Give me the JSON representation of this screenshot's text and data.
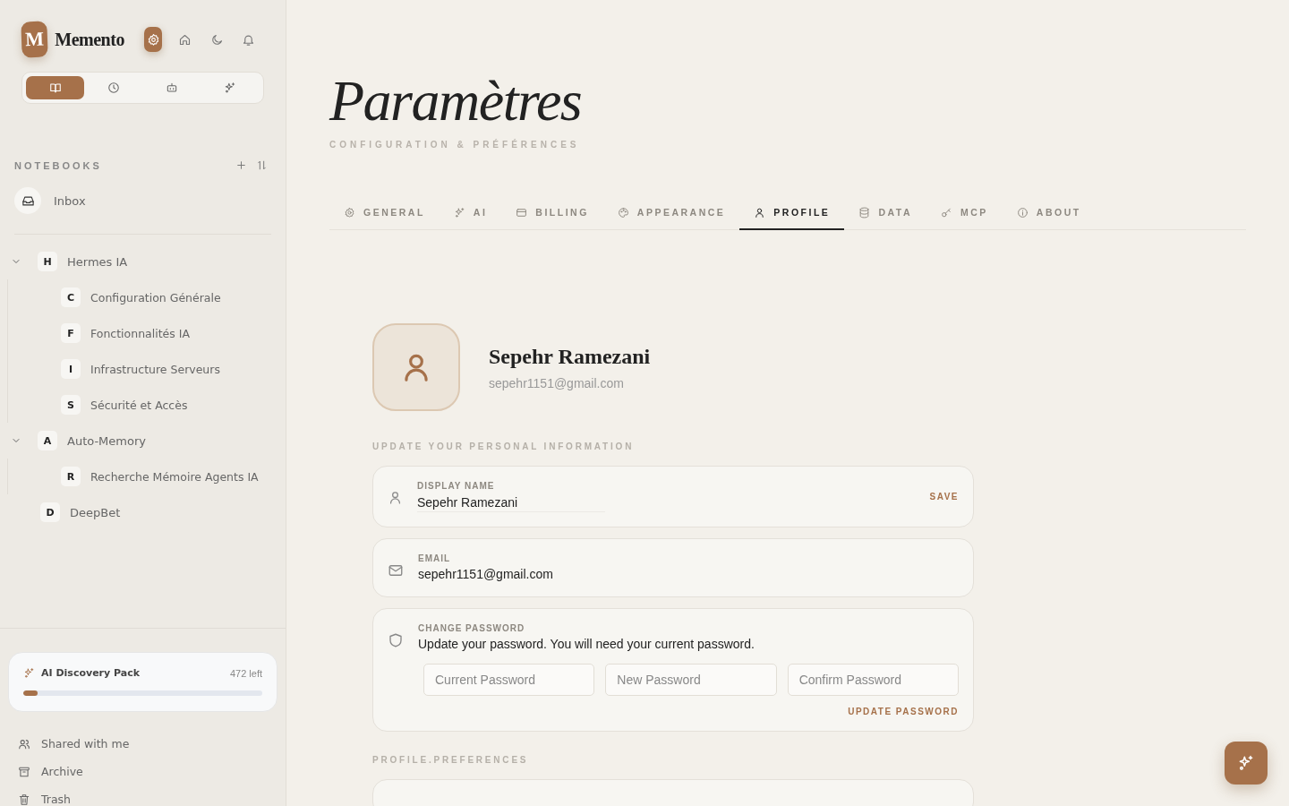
{
  "app": {
    "logo_letter": "M",
    "name": "Memento"
  },
  "top_nav": [
    {
      "kind": "gear",
      "selected": true
    },
    {
      "kind": "home",
      "selected": false
    },
    {
      "kind": "moon",
      "selected": false
    },
    {
      "kind": "bell",
      "selected": false
    }
  ],
  "view_switch": [
    {
      "kind": "book",
      "selected": true
    },
    {
      "kind": "clock",
      "selected": false
    },
    {
      "kind": "robot",
      "selected": false
    },
    {
      "kind": "sparkles",
      "selected": false
    }
  ],
  "notebooks": {
    "title": "NOTEBOOKS",
    "inbox": "Inbox",
    "items": [
      {
        "letter": "H",
        "name": "Hermes IA",
        "expanded": true,
        "children": [
          {
            "letter": "C",
            "name": "Configuration Générale"
          },
          {
            "letter": "F",
            "name": "Fonctionnalités IA"
          },
          {
            "letter": "I",
            "name": "Infrastructure Serveurs"
          },
          {
            "letter": "S",
            "name": "Sécurité et Accès"
          }
        ]
      },
      {
        "letter": "A",
        "name": "Auto-Memory",
        "expanded": true,
        "children": [
          {
            "letter": "R",
            "name": "Recherche Mémoire Agents IA"
          }
        ]
      },
      {
        "letter": "D",
        "name": "DeepBet"
      }
    ]
  },
  "pack": {
    "title": "AI Discovery Pack",
    "remaining": "472 left",
    "level": 0.06
  },
  "footer_links": [
    {
      "kind": "people",
      "label": "Shared with me"
    },
    {
      "kind": "archive",
      "label": "Archive"
    },
    {
      "kind": "trash",
      "label": "Trash"
    }
  ],
  "page": {
    "title": "Paramètres",
    "subtitle": "CONFIGURATION & PRÉFÉRENCES"
  },
  "tabs": [
    {
      "kind": "gear",
      "label": "GENERAL",
      "selected": false
    },
    {
      "kind": "sparkles",
      "label": "AI",
      "selected": false
    },
    {
      "kind": "card",
      "label": "BILLING",
      "selected": false
    },
    {
      "kind": "palette",
      "label": "APPEARANCE",
      "selected": false
    },
    {
      "kind": "user",
      "label": "PROFILE",
      "selected": true
    },
    {
      "kind": "database",
      "label": "DATA",
      "selected": false
    },
    {
      "kind": "key",
      "label": "MCP",
      "selected": false
    },
    {
      "kind": "info",
      "label": "ABOUT",
      "selected": false
    }
  ],
  "profile": {
    "name": "Sepehr Ramezani",
    "email": "sepehr1151@gmail.com"
  },
  "section_personal": "UPDATE YOUR PERSONAL INFORMATION",
  "display_name": {
    "label": "DISPLAY NAME",
    "value": "Sepehr Ramezani",
    "action": "SAVE"
  },
  "email": {
    "label": "EMAIL",
    "value": "sepehr1151@gmail.com"
  },
  "password": {
    "label": "CHANGE PASSWORD",
    "description": "Update your password. You will need your current password.",
    "fields": [
      {
        "placeholder": "Current Password"
      },
      {
        "placeholder": "New Password"
      },
      {
        "placeholder": "Confirm Password"
      }
    ],
    "action": "UPDATE PASSWORD"
  },
  "section_preferences": "PROFILE.PREFERENCES"
}
